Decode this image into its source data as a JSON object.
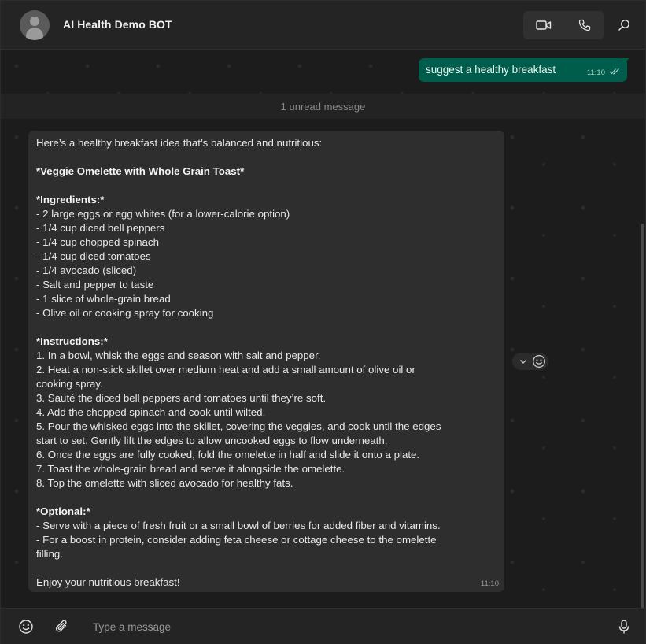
{
  "header": {
    "title": "AI Health Demo BOT",
    "icons": {
      "video": "video-camera-icon",
      "call": "phone-icon",
      "search": "search-icon"
    }
  },
  "messages": {
    "outgoing": {
      "text": "suggest a healthy breakfast",
      "time": "11:10",
      "status_icon": "double-check-icon"
    },
    "unread_divider": "1 unread message",
    "incoming": {
      "time": "11:10",
      "intro": "Here’s a healthy breakfast idea that’s balanced and nutritious:",
      "dish": "*Veggie Omelette with Whole Grain Toast*",
      "ingredients_heading": "*Ingredients:*",
      "ingredients": [
        "- 2 large eggs or egg whites (for a lower-calorie option)",
        "- 1/4 cup diced bell peppers",
        "- 1/4 cup chopped spinach",
        "- 1/4 cup diced tomatoes",
        "- 1/4 avocado (sliced)",
        "- Salt and pepper to taste",
        "- 1 slice of whole-grain bread",
        "- Olive oil or cooking spray for cooking"
      ],
      "instructions_heading": "*Instructions:*",
      "instructions": [
        "1. In a bowl, whisk the eggs and season with salt and pepper.",
        "2. Heat a non-stick skillet over medium heat and add a small amount of olive oil or\ncooking spray.",
        "3. Sauté the diced bell peppers and tomatoes until they’re soft.",
        "4. Add the chopped spinach and cook until wilted.",
        "5. Pour the whisked eggs into the skillet, covering the veggies, and cook until the edges\nstart to set. Gently lift the edges to allow uncooked eggs to flow underneath.",
        "6. Once the eggs are fully cooked, fold the omelette in half and slide it onto a plate.",
        "7. Toast the whole-grain bread and serve it alongside the omelette.",
        "8. Top the omelette with sliced avocado for healthy fats."
      ],
      "optional_heading": "*Optional:*",
      "optional": [
        "- Serve with a piece of fresh fruit or a small bowl of berries for added fiber and vitamins.",
        "- For a boost in protein, consider adding feta cheese or cottage cheese to the omelette\nfilling."
      ],
      "outro": "Enjoy your nutritious breakfast!"
    }
  },
  "composer": {
    "placeholder": "Type a message",
    "icons": {
      "emoji": "emoji-icon",
      "attach": "paperclip-icon",
      "mic": "microphone-icon"
    }
  },
  "colors": {
    "outgoing_bubble": "#005c4b",
    "incoming_bubble": "#2e2e2e",
    "background": "#1c1c1c"
  }
}
